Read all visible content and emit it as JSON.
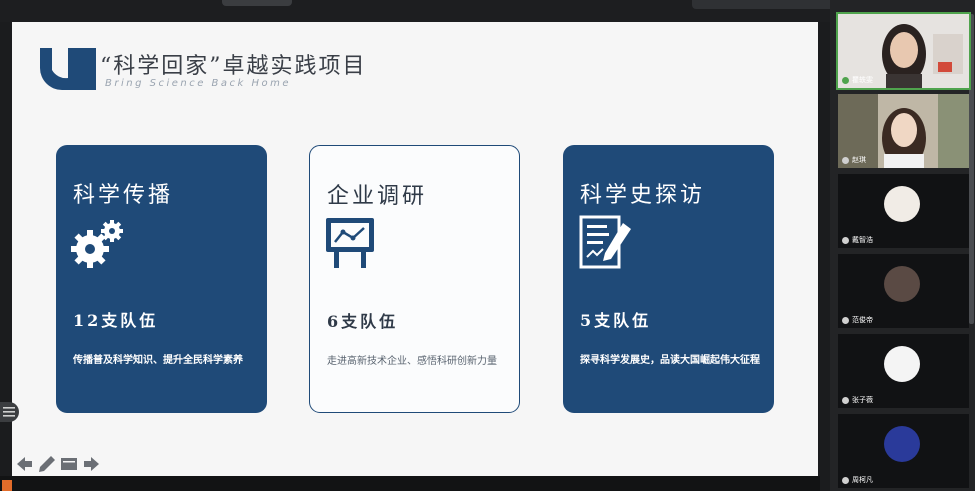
{
  "slide": {
    "title": "“科学回家”卓越实践项目",
    "subtitle": "Bring Science Back Home",
    "cards": [
      {
        "title": "科学传播",
        "icon": "gears-icon",
        "count": "12支队伍",
        "desc": "传播普及科学知识、提升全民科学素养"
      },
      {
        "title": "企业调研",
        "icon": "presentation-board-icon",
        "count": "6支队伍",
        "desc": "走进高新技术企业、感悟科研创新力量"
      },
      {
        "title": "科学史探访",
        "icon": "document-pen-icon",
        "count": "5支队伍",
        "desc": "探寻科学发展史，品读大国崛起伟大征程"
      }
    ]
  },
  "participants": [
    {
      "name": "瞿轶雯"
    },
    {
      "name": "赵琪"
    },
    {
      "name": "戴智浩"
    },
    {
      "name": "范俊帝"
    },
    {
      "name": "张子薇"
    },
    {
      "name": "周柯凡"
    }
  ],
  "colors": {
    "brand": "#1f4a78",
    "slide_bg": "#f6f6f6",
    "active_speaker": "#4fa34d"
  },
  "toolbar_icons": [
    "arrow-left-icon",
    "pen-icon",
    "screen-icon",
    "arrow-right-icon"
  ]
}
